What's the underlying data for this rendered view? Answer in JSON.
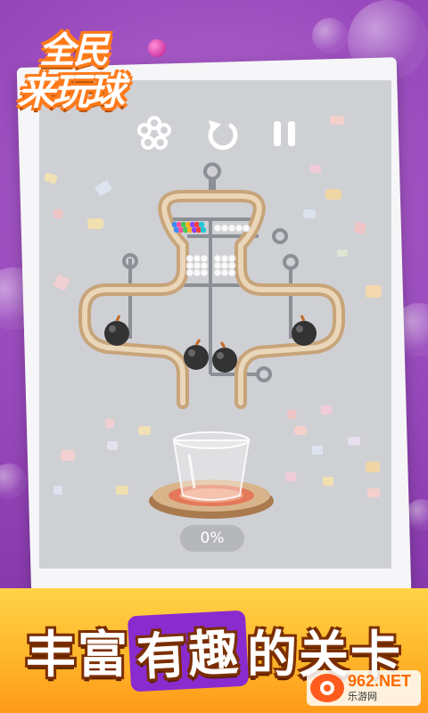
{
  "app": {
    "logo_line_1": "全民",
    "logo_line_2": "来玩球"
  },
  "toolbar": {
    "hint_icon": "gear-icon",
    "restart_icon": "restart-icon",
    "pause_icon": "pause-icon"
  },
  "puzzle": {
    "progress_text": "0%",
    "progress_value": 0,
    "colored_balls": [
      "#3a8bff",
      "#ff4fa3",
      "#43c85a",
      "#ffb020",
      "#8b46ff",
      "#ff3b3b",
      "#1ec8d7"
    ],
    "bomb_count": 4
  },
  "banner": {
    "text_1": "丰富",
    "text_hl": "有趣",
    "text_2": "的关卡"
  },
  "watermark": {
    "main": "962.NET",
    "sub": "乐游网"
  },
  "colors": {
    "background": "#9a4bbd",
    "board": "#cfd0d4",
    "banner": "#ffb62a",
    "highlight": "#8a2bd0",
    "wood": "#e3c6a0"
  }
}
